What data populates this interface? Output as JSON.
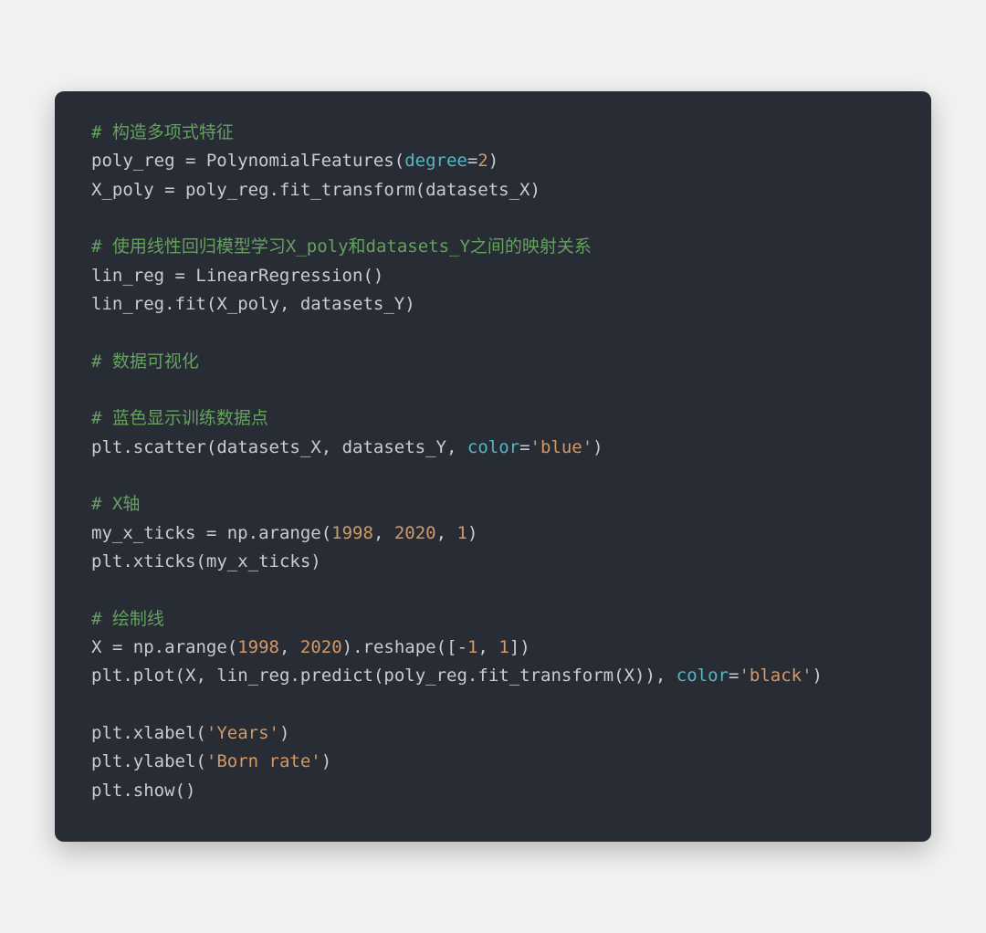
{
  "tokens": [
    {
      "type": "comment",
      "text": "# 构造多项式特征"
    },
    {
      "type": "newline"
    },
    {
      "type": "identifier",
      "text": "poly_reg "
    },
    {
      "type": "operator",
      "text": "= "
    },
    {
      "type": "identifier",
      "text": "PolynomialFeatures"
    },
    {
      "type": "delimiter",
      "text": "("
    },
    {
      "type": "keyword",
      "text": "degree"
    },
    {
      "type": "operator",
      "text": "="
    },
    {
      "type": "number",
      "text": "2"
    },
    {
      "type": "delimiter",
      "text": ")"
    },
    {
      "type": "newline"
    },
    {
      "type": "identifier",
      "text": "X_poly "
    },
    {
      "type": "operator",
      "text": "= "
    },
    {
      "type": "identifier",
      "text": "poly_reg"
    },
    {
      "type": "operator",
      "text": "."
    },
    {
      "type": "identifier",
      "text": "fit_transform"
    },
    {
      "type": "delimiter",
      "text": "("
    },
    {
      "type": "identifier",
      "text": "datasets_X"
    },
    {
      "type": "delimiter",
      "text": ")"
    },
    {
      "type": "newline"
    },
    {
      "type": "newline"
    },
    {
      "type": "comment",
      "text": "# 使用线性回归模型学习X_poly和datasets_Y之间的映射关系"
    },
    {
      "type": "newline"
    },
    {
      "type": "identifier",
      "text": "lin_reg "
    },
    {
      "type": "operator",
      "text": "= "
    },
    {
      "type": "identifier",
      "text": "LinearRegression"
    },
    {
      "type": "delimiter",
      "text": "()"
    },
    {
      "type": "newline"
    },
    {
      "type": "identifier",
      "text": "lin_reg"
    },
    {
      "type": "operator",
      "text": "."
    },
    {
      "type": "identifier",
      "text": "fit"
    },
    {
      "type": "delimiter",
      "text": "("
    },
    {
      "type": "identifier",
      "text": "X_poly"
    },
    {
      "type": "delimiter",
      "text": ", "
    },
    {
      "type": "identifier",
      "text": "datasets_Y"
    },
    {
      "type": "delimiter",
      "text": ")"
    },
    {
      "type": "newline"
    },
    {
      "type": "newline"
    },
    {
      "type": "comment",
      "text": "# 数据可视化"
    },
    {
      "type": "newline"
    },
    {
      "type": "newline"
    },
    {
      "type": "comment",
      "text": "# 蓝色显示训练数据点"
    },
    {
      "type": "newline"
    },
    {
      "type": "identifier",
      "text": "plt"
    },
    {
      "type": "operator",
      "text": "."
    },
    {
      "type": "identifier",
      "text": "scatter"
    },
    {
      "type": "delimiter",
      "text": "("
    },
    {
      "type": "identifier",
      "text": "datasets_X"
    },
    {
      "type": "delimiter",
      "text": ", "
    },
    {
      "type": "identifier",
      "text": "datasets_Y"
    },
    {
      "type": "delimiter",
      "text": ", "
    },
    {
      "type": "keyword",
      "text": "color"
    },
    {
      "type": "operator",
      "text": "="
    },
    {
      "type": "string",
      "text": "'blue'"
    },
    {
      "type": "delimiter",
      "text": ")"
    },
    {
      "type": "newline"
    },
    {
      "type": "newline"
    },
    {
      "type": "comment",
      "text": "# X轴"
    },
    {
      "type": "newline"
    },
    {
      "type": "identifier",
      "text": "my_x_ticks "
    },
    {
      "type": "operator",
      "text": "= "
    },
    {
      "type": "identifier",
      "text": "np"
    },
    {
      "type": "operator",
      "text": "."
    },
    {
      "type": "identifier",
      "text": "arange"
    },
    {
      "type": "delimiter",
      "text": "("
    },
    {
      "type": "number",
      "text": "1998"
    },
    {
      "type": "delimiter",
      "text": ", "
    },
    {
      "type": "number",
      "text": "2020"
    },
    {
      "type": "delimiter",
      "text": ", "
    },
    {
      "type": "number",
      "text": "1"
    },
    {
      "type": "delimiter",
      "text": ")"
    },
    {
      "type": "newline"
    },
    {
      "type": "identifier",
      "text": "plt"
    },
    {
      "type": "operator",
      "text": "."
    },
    {
      "type": "identifier",
      "text": "xticks"
    },
    {
      "type": "delimiter",
      "text": "("
    },
    {
      "type": "identifier",
      "text": "my_x_ticks"
    },
    {
      "type": "delimiter",
      "text": ")"
    },
    {
      "type": "newline"
    },
    {
      "type": "newline"
    },
    {
      "type": "comment",
      "text": "# 绘制线"
    },
    {
      "type": "newline"
    },
    {
      "type": "identifier",
      "text": "X "
    },
    {
      "type": "operator",
      "text": "= "
    },
    {
      "type": "identifier",
      "text": "np"
    },
    {
      "type": "operator",
      "text": "."
    },
    {
      "type": "identifier",
      "text": "arange"
    },
    {
      "type": "delimiter",
      "text": "("
    },
    {
      "type": "number",
      "text": "1998"
    },
    {
      "type": "delimiter",
      "text": ", "
    },
    {
      "type": "number",
      "text": "2020"
    },
    {
      "type": "delimiter",
      "text": ")"
    },
    {
      "type": "operator",
      "text": "."
    },
    {
      "type": "identifier",
      "text": "reshape"
    },
    {
      "type": "delimiter",
      "text": "(["
    },
    {
      "type": "operator",
      "text": "-"
    },
    {
      "type": "number",
      "text": "1"
    },
    {
      "type": "delimiter",
      "text": ", "
    },
    {
      "type": "number",
      "text": "1"
    },
    {
      "type": "delimiter",
      "text": "])"
    },
    {
      "type": "newline"
    },
    {
      "type": "identifier",
      "text": "plt"
    },
    {
      "type": "operator",
      "text": "."
    },
    {
      "type": "identifier",
      "text": "plot"
    },
    {
      "type": "delimiter",
      "text": "("
    },
    {
      "type": "identifier",
      "text": "X"
    },
    {
      "type": "delimiter",
      "text": ", "
    },
    {
      "type": "identifier",
      "text": "lin_reg"
    },
    {
      "type": "operator",
      "text": "."
    },
    {
      "type": "identifier",
      "text": "predict"
    },
    {
      "type": "delimiter",
      "text": "("
    },
    {
      "type": "identifier",
      "text": "poly_reg"
    },
    {
      "type": "operator",
      "text": "."
    },
    {
      "type": "identifier",
      "text": "fit_transform"
    },
    {
      "type": "delimiter",
      "text": "("
    },
    {
      "type": "identifier",
      "text": "X"
    },
    {
      "type": "delimiter",
      "text": "))"
    },
    {
      "type": "delimiter",
      "text": ", "
    },
    {
      "type": "keyword",
      "text": "color"
    },
    {
      "type": "operator",
      "text": "="
    },
    {
      "type": "string",
      "text": "'black'"
    },
    {
      "type": "delimiter",
      "text": ")"
    },
    {
      "type": "newline"
    },
    {
      "type": "newline"
    },
    {
      "type": "identifier",
      "text": "plt"
    },
    {
      "type": "operator",
      "text": "."
    },
    {
      "type": "identifier",
      "text": "xlabel"
    },
    {
      "type": "delimiter",
      "text": "("
    },
    {
      "type": "string",
      "text": "'Years'"
    },
    {
      "type": "delimiter",
      "text": ")"
    },
    {
      "type": "newline"
    },
    {
      "type": "identifier",
      "text": "plt"
    },
    {
      "type": "operator",
      "text": "."
    },
    {
      "type": "identifier",
      "text": "ylabel"
    },
    {
      "type": "delimiter",
      "text": "("
    },
    {
      "type": "string",
      "text": "'Born rate'"
    },
    {
      "type": "delimiter",
      "text": ")"
    },
    {
      "type": "newline"
    },
    {
      "type": "identifier",
      "text": "plt"
    },
    {
      "type": "operator",
      "text": "."
    },
    {
      "type": "identifier",
      "text": "show"
    },
    {
      "type": "delimiter",
      "text": "()"
    },
    {
      "type": "newline"
    }
  ]
}
